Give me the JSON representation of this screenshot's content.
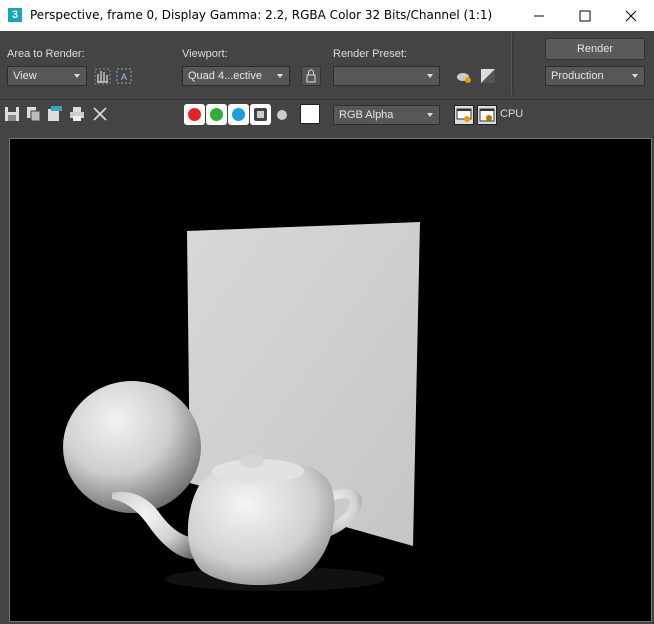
{
  "window": {
    "app_icon_text": "3",
    "title": "Perspective, frame 0, Display Gamma: 2.2, RGBA Color 32 Bits/Channel (1:1)",
    "controls": [
      "minimize-icon",
      "maximize-icon",
      "close-icon"
    ]
  },
  "render_setup": {
    "area_label": "Area to Render:",
    "area_value": "View",
    "viewport_label": "Viewport:",
    "viewport_value": "Quad 4...ective",
    "preset_label": "Render Preset:",
    "preset_value": "",
    "render_button": "Render",
    "render_mode": "Production"
  },
  "toolbar": {
    "channels": [
      {
        "name": "red",
        "color": "#e52222"
      },
      {
        "name": "green",
        "color": "#2fae3a"
      },
      {
        "name": "blue",
        "color": "#1a9ee0"
      }
    ],
    "display_channel": "RGB Alpha",
    "renderer_label": "CPU",
    "swatch_color": "#ffffff"
  },
  "colors": {
    "bg": "#444444",
    "viewer_bg": "#000000"
  }
}
